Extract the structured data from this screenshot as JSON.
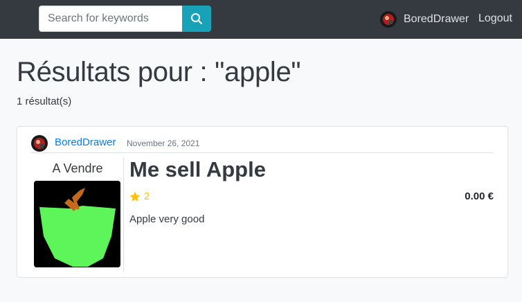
{
  "navbar": {
    "search_placeholder": "Search for keywords",
    "username": "BoredDrawer",
    "logout_label": "Logout",
    "accent_color": "#17a2b8"
  },
  "results": {
    "title": "Résultats pour : \"apple\"",
    "count_text": "1 résultat(s)"
  },
  "post": {
    "author": "BoredDrawer",
    "date": "November 26, 2021",
    "status": "A Vendre",
    "title": "Me sell Apple",
    "rating": "2",
    "price": "0.00 €",
    "description": "Apple very good"
  }
}
